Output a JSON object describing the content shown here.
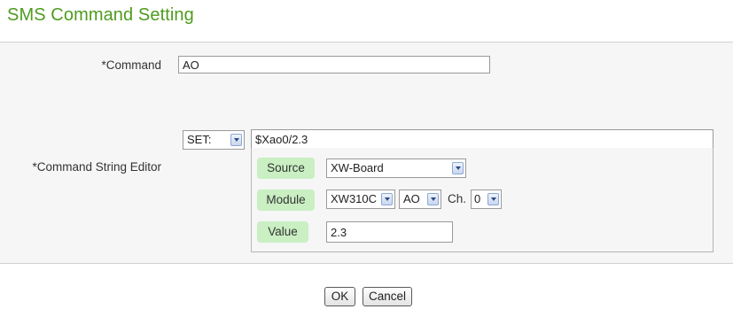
{
  "title": "SMS Command Setting",
  "command": {
    "label": "*Command",
    "value": "AO"
  },
  "editor": {
    "label": "*Command String Editor",
    "set_select": {
      "value": "SET:"
    },
    "command_string": "$Xao0/2.3",
    "source": {
      "label": "Source",
      "value": "XW-Board"
    },
    "module": {
      "label": "Module",
      "module_value": "XW310C",
      "type_value": "AO",
      "ch_label": "Ch.",
      "ch_value": "0"
    },
    "value": {
      "label": "Value",
      "value": "2.3"
    }
  },
  "buttons": {
    "ok": "OK",
    "cancel": "Cancel"
  },
  "icons": {
    "dropdown": "chevron-down-icon"
  }
}
